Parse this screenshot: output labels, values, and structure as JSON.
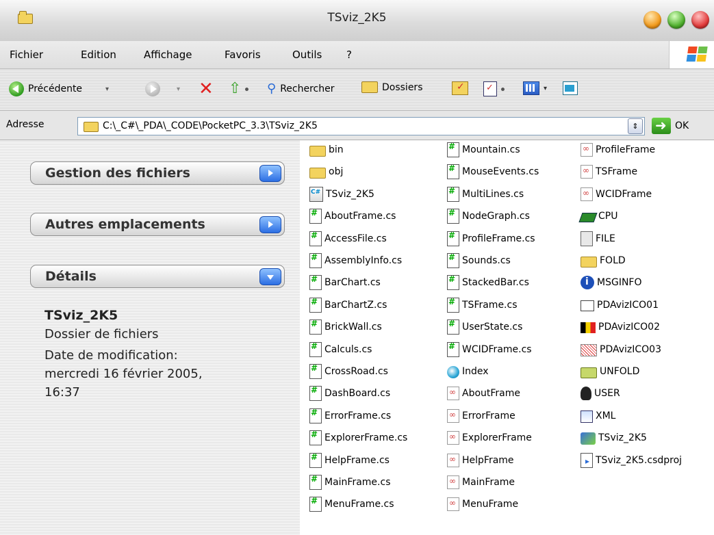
{
  "window": {
    "title": "TSviz_2K5"
  },
  "menu": [
    "Fichier",
    "Edition",
    "Affichage",
    "Favoris",
    "Outils",
    "?"
  ],
  "toolbar": {
    "back_label": "Précédente",
    "search_label": "Rechercher",
    "folders_label": "Dossiers"
  },
  "address": {
    "label": "Adresse",
    "value": "C:\\_C#\\_PDA\\_CODE\\PocketPC_3.3\\TSviz_2K5",
    "ok_label": "OK"
  },
  "tasks": {
    "file_management": "Gestion des fichiers",
    "other_places": "Autres emplacements",
    "details": "Détails"
  },
  "details": {
    "name": "TSviz_2K5",
    "type": "Dossier de fichiers",
    "modified_label": "Date de modification:",
    "modified_value_line1": "mercredi 16 février 2005,",
    "modified_value_line2": "16:37"
  },
  "files": {
    "col1": [
      {
        "name": "bin",
        "icon": "folder-icon"
      },
      {
        "name": "obj",
        "icon": "folder-icon"
      },
      {
        "name": "TSviz_2K5",
        "icon": "project-icon"
      },
      {
        "name": "AboutFrame.cs",
        "icon": "cs-file-icon"
      },
      {
        "name": "AccessFile.cs",
        "icon": "cs-file-icon"
      },
      {
        "name": "AssemblyInfo.cs",
        "icon": "cs-file-icon"
      },
      {
        "name": "BarChart.cs",
        "icon": "cs-file-icon"
      },
      {
        "name": "BarChartZ.cs",
        "icon": "cs-file-icon"
      },
      {
        "name": "BrickWall.cs",
        "icon": "cs-file-icon"
      },
      {
        "name": "Calculs.cs",
        "icon": "cs-file-icon"
      },
      {
        "name": "CrossRoad.cs",
        "icon": "cs-file-icon"
      },
      {
        "name": "DashBoard.cs",
        "icon": "cs-file-icon"
      },
      {
        "name": "ErrorFrame.cs",
        "icon": "cs-file-icon"
      },
      {
        "name": "ExplorerFrame.cs",
        "icon": "cs-file-icon"
      },
      {
        "name": "HelpFrame.cs",
        "icon": "cs-file-icon"
      },
      {
        "name": "MainFrame.cs",
        "icon": "cs-file-icon"
      },
      {
        "name": "MenuFrame.cs",
        "icon": "cs-file-icon"
      }
    ],
    "col2": [
      {
        "name": "Mountain.cs",
        "icon": "cs-file-icon"
      },
      {
        "name": "MouseEvents.cs",
        "icon": "cs-file-icon"
      },
      {
        "name": "MultiLines.cs",
        "icon": "cs-file-icon"
      },
      {
        "name": "NodeGraph.cs",
        "icon": "cs-file-icon"
      },
      {
        "name": "ProfileFrame.cs",
        "icon": "cs-file-icon"
      },
      {
        "name": "Sounds.cs",
        "icon": "cs-file-icon"
      },
      {
        "name": "StackedBar.cs",
        "icon": "cs-file-icon"
      },
      {
        "name": "TSFrame.cs",
        "icon": "cs-file-icon"
      },
      {
        "name": "UserState.cs",
        "icon": "cs-file-icon"
      },
      {
        "name": "WCIDFrame.cs",
        "icon": "cs-file-icon"
      },
      {
        "name": "Index",
        "icon": "html-file-icon"
      },
      {
        "name": "AboutFrame",
        "icon": "form-resource-icon"
      },
      {
        "name": "ErrorFrame",
        "icon": "form-resource-icon"
      },
      {
        "name": "ExplorerFrame",
        "icon": "form-resource-icon"
      },
      {
        "name": "HelpFrame",
        "icon": "form-resource-icon"
      },
      {
        "name": "MainFrame",
        "icon": "form-resource-icon"
      },
      {
        "name": "MenuFrame",
        "icon": "form-resource-icon"
      }
    ],
    "col3": [
      {
        "name": "ProfileFrame",
        "icon": "form-resource-icon"
      },
      {
        "name": "TSFrame",
        "icon": "form-resource-icon"
      },
      {
        "name": "WCIDFrame",
        "icon": "form-resource-icon"
      },
      {
        "name": "CPU",
        "icon": "chip-icon"
      },
      {
        "name": "FILE",
        "icon": "document-icon"
      },
      {
        "name": "FOLD",
        "icon": "folder-icon"
      },
      {
        "name": "MSGINFO",
        "icon": "info-icon"
      },
      {
        "name": "PDAvizICO01",
        "icon": "window-icon"
      },
      {
        "name": "PDAvizICO02",
        "icon": "flag-icon"
      },
      {
        "name": "PDAvizICO03",
        "icon": "chart-icon"
      },
      {
        "name": "UNFOLD",
        "icon": "open-folder-icon"
      },
      {
        "name": "USER",
        "icon": "user-icon"
      },
      {
        "name": "XML",
        "icon": "xml-icon"
      },
      {
        "name": "TSviz_2K5",
        "icon": "executable-icon"
      },
      {
        "name": "TSviz_2K5.csdproj",
        "icon": "csdproj-icon"
      }
    ]
  },
  "colors": {
    "accent_blue": "#2c6ee3",
    "title_bg": "#dcdcdc"
  }
}
